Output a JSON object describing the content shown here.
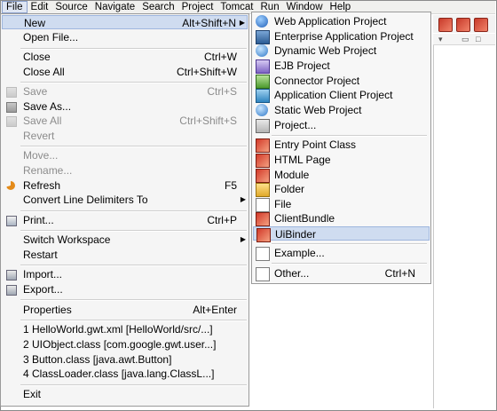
{
  "menubar": {
    "items": [
      "File",
      "Edit",
      "Source",
      "Navigate",
      "Search",
      "Project",
      "Tomcat",
      "Run",
      "Window",
      "Help"
    ]
  },
  "file_menu": {
    "new": {
      "label": "New",
      "shortcut": "Alt+Shift+N"
    },
    "open_file": {
      "label": "Open File..."
    },
    "close": {
      "label": "Close",
      "shortcut": "Ctrl+W"
    },
    "close_all": {
      "label": "Close All",
      "shortcut": "Ctrl+Shift+W"
    },
    "save": {
      "label": "Save",
      "shortcut": "Ctrl+S"
    },
    "save_as": {
      "label": "Save As..."
    },
    "save_all": {
      "label": "Save All",
      "shortcut": "Ctrl+Shift+S"
    },
    "revert": {
      "label": "Revert"
    },
    "move": {
      "label": "Move..."
    },
    "rename": {
      "label": "Rename..."
    },
    "refresh": {
      "label": "Refresh",
      "shortcut": "F5"
    },
    "convert_line_delimiters": {
      "label": "Convert Line Delimiters To"
    },
    "print": {
      "label": "Print...",
      "shortcut": "Ctrl+P"
    },
    "switch_workspace": {
      "label": "Switch Workspace"
    },
    "restart": {
      "label": "Restart"
    },
    "import": {
      "label": "Import..."
    },
    "export": {
      "label": "Export..."
    },
    "properties": {
      "label": "Properties",
      "shortcut": "Alt+Enter"
    },
    "recent": [
      "1 HelloWorld.gwt.xml  [HelloWorld/src/...]",
      "2 UIObject.class  [com.google.gwt.user...]",
      "3 Button.class  [java.awt.Button]",
      "4 ClassLoader.class  [java.lang.ClassL...]"
    ],
    "exit": {
      "label": "Exit"
    }
  },
  "new_submenu": {
    "items": [
      {
        "label": "Web Application Project",
        "icon": "gwt-globe-icon"
      },
      {
        "label": "Enterprise Application Project",
        "icon": "enterprise-app-icon"
      },
      {
        "label": "Dynamic Web Project",
        "icon": "dynamic-web-icon"
      },
      {
        "label": "EJB Project",
        "icon": "ejb-icon"
      },
      {
        "label": "Connector Project",
        "icon": "connector-icon"
      },
      {
        "label": "Application Client Project",
        "icon": "app-client-icon"
      },
      {
        "label": "Static Web Project",
        "icon": "static-web-icon"
      },
      {
        "label": "Project...",
        "icon": "project-icon"
      },
      {
        "label": "Entry Point Class",
        "icon": "gwt-entry-point-icon"
      },
      {
        "label": "HTML Page",
        "icon": "gwt-html-icon"
      },
      {
        "label": "Module",
        "icon": "gwt-module-icon"
      },
      {
        "label": "Folder",
        "icon": "folder-icon"
      },
      {
        "label": "File",
        "icon": "file-icon"
      },
      {
        "label": "ClientBundle",
        "icon": "gwt-clientbundle-icon"
      },
      {
        "label": "UiBinder",
        "icon": "gwt-uibinder-icon"
      },
      {
        "label": "Example...",
        "icon": "example-icon"
      },
      {
        "label": "Other...",
        "icon": "other-icon",
        "shortcut": "Ctrl+N"
      }
    ],
    "highlighted": "UiBinder"
  }
}
